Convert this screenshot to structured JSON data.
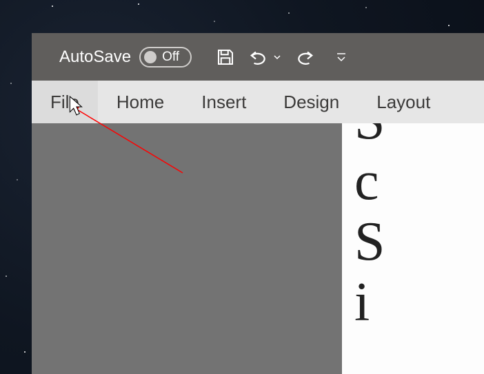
{
  "titleBar": {
    "autoSaveLabel": "AutoSave",
    "toggleState": "Off"
  },
  "ribbon": {
    "tabs": [
      {
        "id": "file",
        "label": "File",
        "active": true
      },
      {
        "id": "home",
        "label": "Home",
        "active": false
      },
      {
        "id": "insert",
        "label": "Insert",
        "active": false
      },
      {
        "id": "design",
        "label": "Design",
        "active": false
      },
      {
        "id": "layout",
        "label": "Layout",
        "active": false
      }
    ]
  },
  "document": {
    "visibleText": "S\nc\nS\ni"
  },
  "icons": {
    "save": "save-icon",
    "undo": "undo-icon",
    "redo": "redo-icon",
    "customize": "customize-icon"
  }
}
